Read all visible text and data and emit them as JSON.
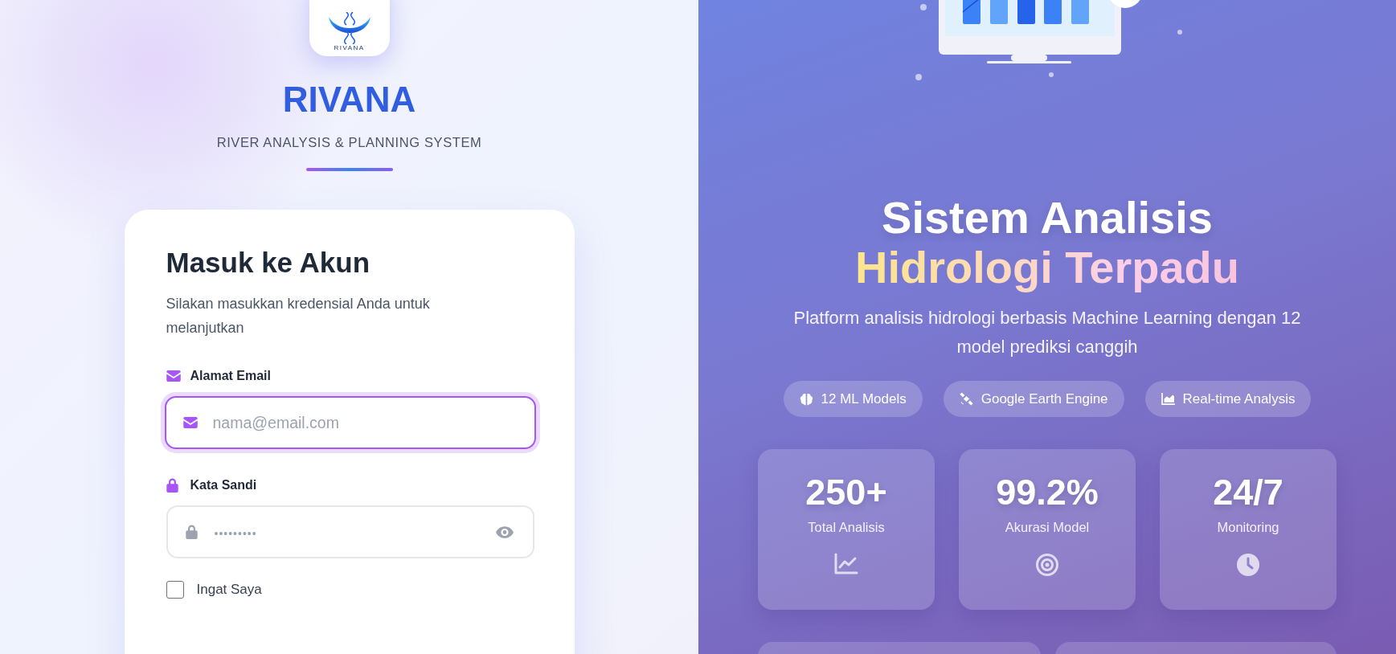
{
  "brand": {
    "logo_caption": "RIVANA",
    "name": "RIVANA",
    "tagline": "RIVER ANALYSIS & PLANNING SYSTEM"
  },
  "login": {
    "title": "Masuk ke Akun",
    "subtitle": "Silakan masukkan kredensial Anda untuk melanjutkan",
    "fields": [
      {
        "kind": "email",
        "label": "Alamat Email",
        "placeholder": "nama@email.com",
        "focused": true
      },
      {
        "kind": "password",
        "label": "Kata Sandi",
        "placeholder": "•••••••••",
        "focused": false
      }
    ],
    "remember": {
      "label": "Ingat Saya",
      "checked": false
    }
  },
  "hero": {
    "title_line1": "Sistem Analisis",
    "title_line2": "Hidrologi Terpadu",
    "description": "Platform analisis hidrologi berbasis Machine Learning dengan 12 model prediksi canggih",
    "badges": [
      {
        "label": "12 ML Models"
      },
      {
        "label": "Google Earth Engine"
      },
      {
        "label": "Real-time Analysis"
      }
    ],
    "stats": [
      {
        "value": "250+",
        "label": "Total Analisis"
      },
      {
        "value": "99.2%",
        "label": "Akurasi Model"
      },
      {
        "value": "24/7",
        "label": "Monitoring"
      }
    ]
  }
}
